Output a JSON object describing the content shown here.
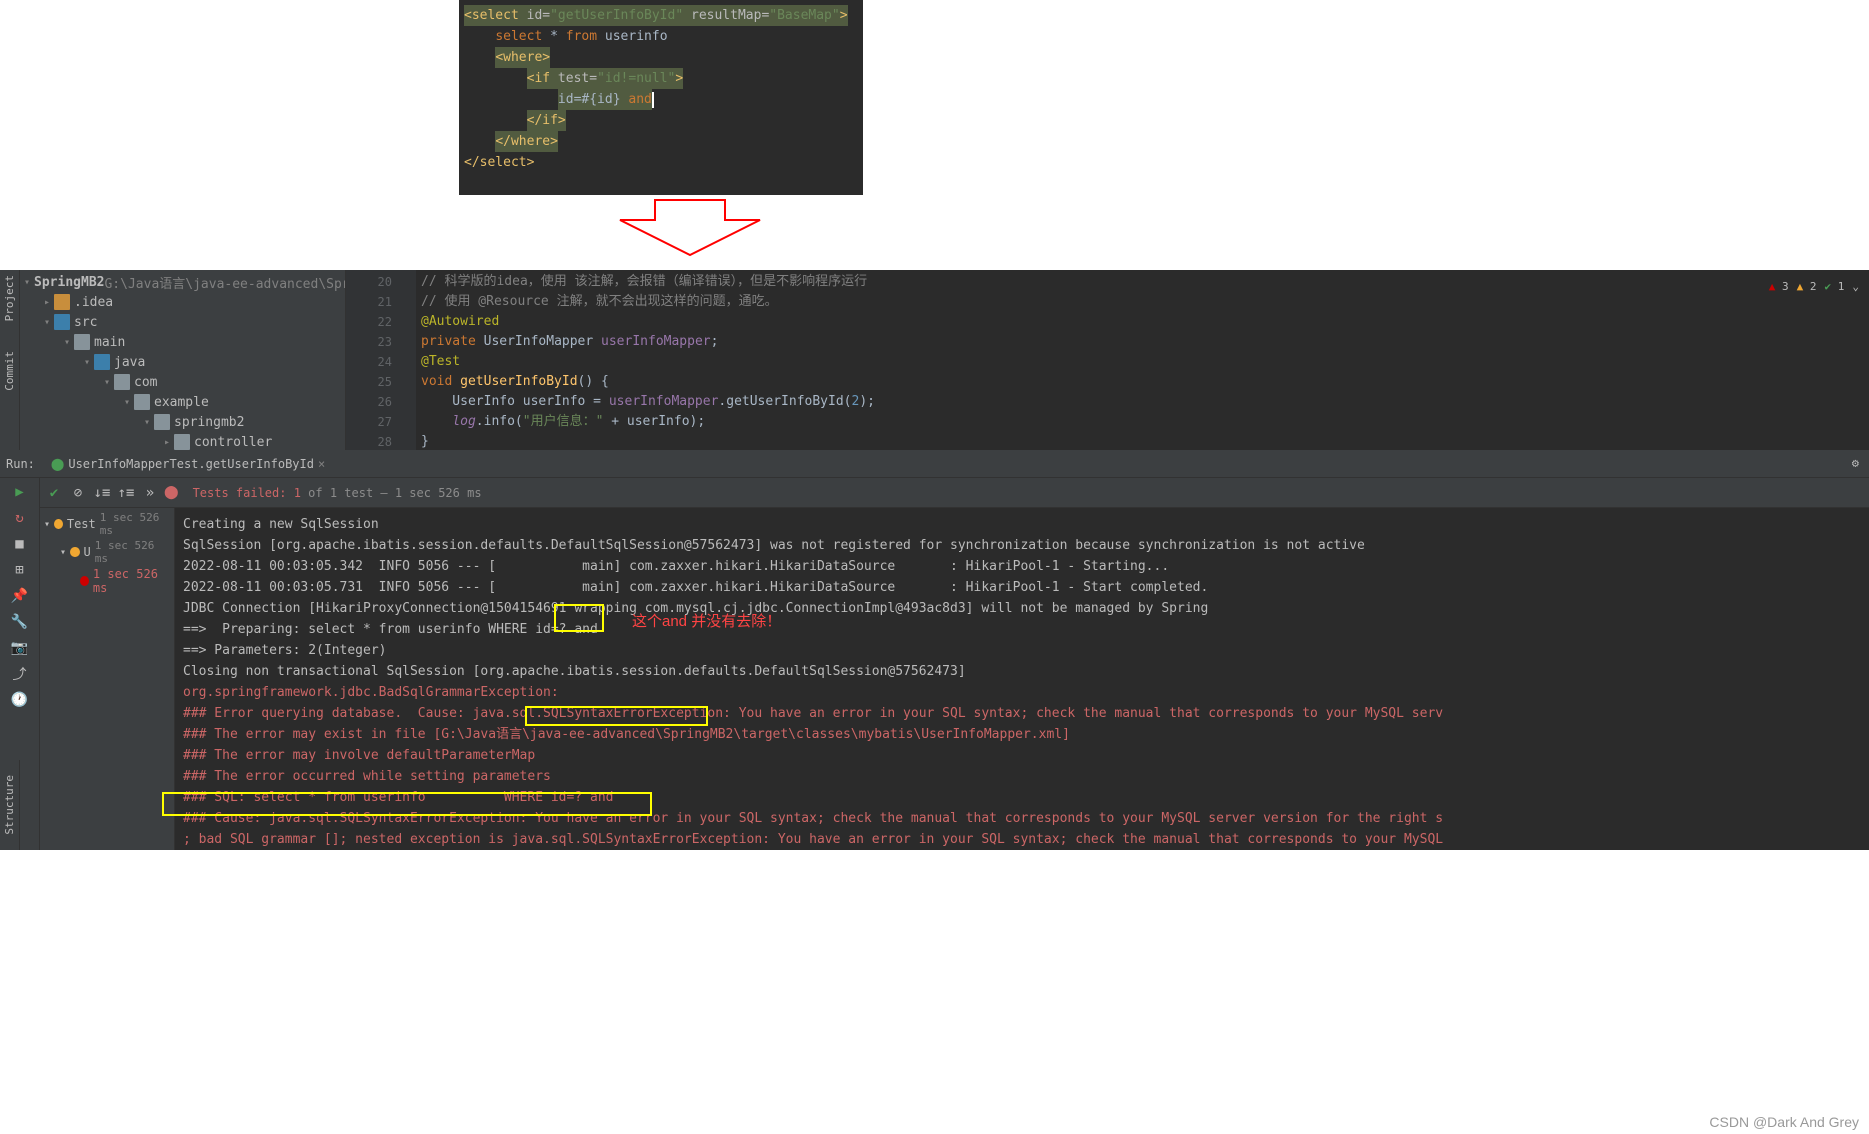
{
  "xml": {
    "select_open": "<select",
    "id_attr": " id=",
    "id_val": "\"getUserInfoById\"",
    "resultmap_attr": " resultMap=",
    "resultmap_val": "\"BaseMap\"",
    "close": ">",
    "select_kw": "select",
    "star": " * ",
    "from_kw": "from",
    "table": " userinfo",
    "where_open": "<where>",
    "if_open": "<if",
    "test_attr": " test=",
    "test_val": "\"id!=null\"",
    "id_expr": "id=#{id} ",
    "and_kw": "and",
    "if_close": "</if>",
    "where_close": "</where>",
    "select_close": "</select>"
  },
  "project": {
    "root": "SpringMB2",
    "root_path": " G:\\Java语言\\java-ee-advanced\\SpringMB",
    "idea": ".idea",
    "src": "src",
    "main": "main",
    "java": "java",
    "com": "com",
    "example": "example",
    "springmb2": "springmb2",
    "controller": "controller"
  },
  "editor": {
    "lines": [
      {
        "n": "20",
        "c1": "// 科学版的idea，使用 该注解，会报错（编译错误），但是不影响程序运行"
      },
      {
        "n": "21",
        "c1": "// 使用 @Resource 注解，就不会出现这样的问题，通吃。"
      },
      {
        "n": "22",
        "anno": "@Autowired"
      },
      {
        "n": "23",
        "kw": "private ",
        "type": "UserInfoMapper ",
        "field": "userInfoMapper",
        "semi": ";"
      },
      {
        "n": "24",
        "anno": "@Test"
      },
      {
        "n": "25",
        "kw": "void ",
        "method": "getUserInfoById",
        "paren": "() {"
      },
      {
        "n": "26",
        "body": "    UserInfo userInfo = ",
        "call": "userInfoMapper",
        "dot": ".getUserInfoById(",
        "num": "2",
        "end": ");"
      },
      {
        "n": "27",
        "body": "    ",
        "log": "log",
        "dot2": ".info(",
        "str": "\"用户信息：\"",
        "plus": " + userInfo);"
      },
      {
        "n": "28",
        "brace": "}"
      }
    ]
  },
  "status": {
    "err": "3",
    "warn": "2",
    "ok": "1"
  },
  "run": {
    "title": "Run:",
    "tab": "UserInfoMapperTest.getUserInfoById",
    "fail_msg": "Tests failed: 1",
    "fail_suffix": " of 1 test – 1 sec 526 ms",
    "tree": {
      "test": "Test",
      "test_time": "1 sec 526 ms",
      "u": "U",
      "u_time": "1 sec 526 ms",
      "leaf_time": "1 sec 526 ms"
    },
    "console": [
      "Creating a new SqlSession",
      "SqlSession [org.apache.ibatis.session.defaults.DefaultSqlSession@57562473] was not registered for synchronization because synchronization is not active",
      "2022-08-11 00:03:05.342  INFO 5056 --- [           main] com.zaxxer.hikari.HikariDataSource       : HikariPool-1 - Starting...",
      "2022-08-11 00:03:05.731  INFO 5056 --- [           main] com.zaxxer.hikari.HikariDataSource       : HikariPool-1 - Start completed.",
      "JDBC Connection [HikariProxyConnection@1504154691 wrapping com.mysql.cj.jdbc.ConnectionImpl@493ac8d3] will not be managed by Spring",
      "==>  Preparing: select * from userinfo WHERE id=? and",
      "==> Parameters: 2(Integer)",
      "Closing non transactional SqlSession [org.apache.ibatis.session.defaults.DefaultSqlSession@57562473]",
      "",
      "org.springframework.jdbc.BadSqlGrammarException:",
      "### Error querying database.  Cause: java.sql.SQLSyntaxErrorException: You have an error in your SQL syntax; check the manual that corresponds to your MySQL serv",
      "### The error may exist in file [G:\\Java语言\\java-ee-advanced\\SpringMB2\\target\\classes\\mybatis\\UserInfoMapper.xml]",
      "### The error may involve defaultParameterMap",
      "### The error occurred while setting parameters",
      "### SQL: select * from userinfo          WHERE id=? and",
      "### Cause: java.sql.SQLSyntaxErrorException: You have an error in your SQL syntax; check the manual that corresponds to your MySQL server version for the right s",
      "; bad SQL grammar []; nested exception is java.sql.SQLSyntaxErrorException: You have an error in your SQL syntax; check the manual that corresponds to your MySQL"
    ]
  },
  "annotation": {
    "and_note": "这个and 并没有去除！"
  },
  "side_tabs": {
    "project": "Project",
    "commit": "Commit",
    "structure": "Structure"
  },
  "watermark": "CSDN @Dark And Grey"
}
